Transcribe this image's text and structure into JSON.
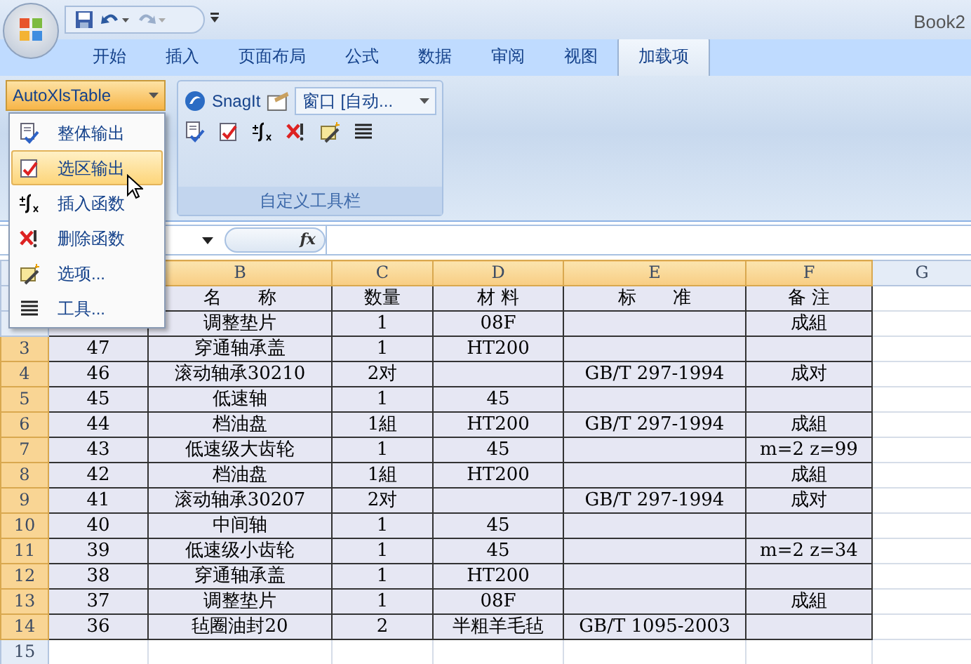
{
  "window": {
    "title": "Book2"
  },
  "tabs": [
    {
      "label": "开始",
      "selected": false
    },
    {
      "label": "插入",
      "selected": false
    },
    {
      "label": "页面布局",
      "selected": false
    },
    {
      "label": "公式",
      "selected": false
    },
    {
      "label": "数据",
      "selected": false
    },
    {
      "label": "审阅",
      "selected": false
    },
    {
      "label": "视图",
      "selected": false
    },
    {
      "label": "加载项",
      "selected": true
    }
  ],
  "ribbon": {
    "autoxls_button": "AutoXlsTable",
    "snagit_button": "SnagIt",
    "window_combo": "窗口 [自动...",
    "group_label": "自定义工具栏"
  },
  "menu": {
    "items": [
      {
        "label": "整体输出",
        "selected": false,
        "kind": "export"
      },
      {
        "label": "选区输出",
        "selected": true,
        "kind": "export-range"
      },
      {
        "label": "插入函数",
        "selected": false,
        "kind": "function"
      },
      {
        "label": "删除函数",
        "selected": false,
        "kind": "delete"
      },
      {
        "label": "选项...",
        "selected": false,
        "kind": "options"
      },
      {
        "label": "工具...",
        "selected": false,
        "kind": "tools"
      }
    ]
  },
  "formula_bar": {
    "fx_label": "fx"
  },
  "sheet": {
    "columns": [
      null,
      {
        "label": "B",
        "selected": true
      },
      {
        "label": "C",
        "selected": true
      },
      {
        "label": "D",
        "selected": true
      },
      {
        "label": "E",
        "selected": true
      },
      {
        "label": "F",
        "selected": true
      },
      {
        "label": "G",
        "selected": false
      }
    ],
    "rows": [
      {
        "number": null,
        "cells": [
          null,
          "名　　称",
          "数量",
          "材 料",
          "标　　准",
          "备 注"
        ]
      },
      {
        "number": null,
        "cells": [
          null,
          "调整垫片",
          "1",
          "08F",
          "",
          "成組"
        ]
      },
      {
        "number": "3",
        "selected": true,
        "cells": [
          "47",
          "穿通轴承盖",
          "1",
          "HT200",
          "",
          ""
        ]
      },
      {
        "number": "4",
        "selected": true,
        "cells": [
          "46",
          "滚动轴承30210",
          "2对",
          "",
          "GB/T 297-1994",
          "成对"
        ]
      },
      {
        "number": "5",
        "selected": true,
        "cells": [
          "45",
          "低速轴",
          "1",
          "45",
          "",
          ""
        ]
      },
      {
        "number": "6",
        "selected": true,
        "cells": [
          "44",
          "档油盘",
          "1組",
          "HT200",
          "GB/T 297-1994",
          "成組"
        ]
      },
      {
        "number": "7",
        "selected": true,
        "cells": [
          "43",
          "低速级大齿轮",
          "1",
          "45",
          "",
          "m=2 z=99"
        ]
      },
      {
        "number": "8",
        "selected": true,
        "cells": [
          "42",
          "档油盘",
          "1組",
          "HT200",
          "",
          "成組"
        ]
      },
      {
        "number": "9",
        "selected": true,
        "cells": [
          "41",
          "滚动轴承30207",
          "2对",
          "",
          "GB/T 297-1994",
          "成对"
        ]
      },
      {
        "number": "10",
        "selected": true,
        "cells": [
          "40",
          "中间轴",
          "1",
          "45",
          "",
          ""
        ]
      },
      {
        "number": "11",
        "selected": true,
        "cells": [
          "39",
          "低速级小齿轮",
          "1",
          "45",
          "",
          "m=2 z=34"
        ]
      },
      {
        "number": "12",
        "selected": true,
        "cells": [
          "38",
          "穿通轴承盖",
          "1",
          "HT200",
          "",
          ""
        ]
      },
      {
        "number": "13",
        "selected": true,
        "cells": [
          "37",
          "调整垫片",
          "1",
          "08F",
          "",
          "成組"
        ]
      },
      {
        "number": "14",
        "selected": true,
        "cells": [
          "36",
          "毡圈油封20",
          "2",
          "半粗羊毛毡",
          "GB/T 1095-2003",
          ""
        ]
      },
      {
        "number": "15",
        "selected": false,
        "cells": []
      }
    ]
  }
}
